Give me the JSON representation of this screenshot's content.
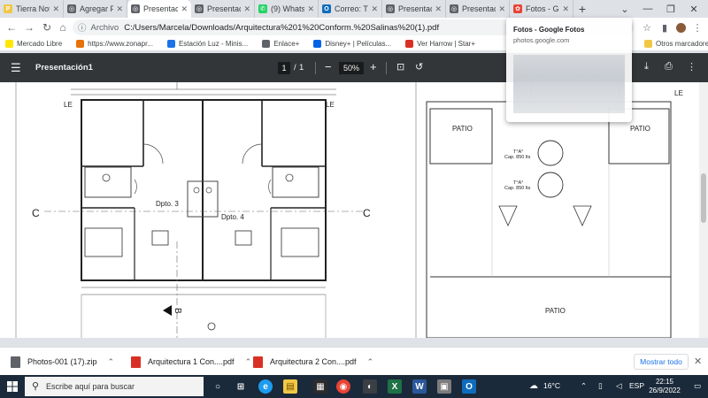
{
  "browser": {
    "tabs": [
      {
        "title": "Tierra Noti",
        "color": "#f2c744",
        "glyph": "P"
      },
      {
        "title": "Agregar Pa",
        "color": "#5f6368",
        "glyph": "◎"
      },
      {
        "title": "Presentaci",
        "color": "#5f6368",
        "glyph": "◎",
        "active": true
      },
      {
        "title": "Presentaci",
        "color": "#5f6368",
        "glyph": "◎"
      },
      {
        "title": "(9) Whats",
        "color": "#25d366",
        "glyph": "✆"
      },
      {
        "title": "Correo: Tie",
        "color": "#0f6cbd",
        "glyph": "O"
      },
      {
        "title": "Presentaci",
        "color": "#5f6368",
        "glyph": "◎"
      },
      {
        "title": "Presentaci",
        "color": "#5f6368",
        "glyph": "◎"
      },
      {
        "title": "Fotos - Go",
        "color": "#ea4335",
        "glyph": "✿"
      }
    ],
    "new_tab": "+",
    "address": {
      "scheme": "Archivo",
      "url": "C:/Users/Marcela/Downloads/Arquitectura%201%20Conform.%20Salinas%20(1).pdf"
    },
    "bookmarks": [
      {
        "label": "Mercado Libre",
        "color": "#ffe600"
      },
      {
        "label": "https://www.zonapr...",
        "color": "#e8710a"
      },
      {
        "label": "Estación Luz - Minis...",
        "color": "#1a73e8"
      },
      {
        "label": "Enlace+",
        "color": "#5f6368"
      },
      {
        "label": "Disney+ | Películas...",
        "color": "#0063e5"
      },
      {
        "label": "Ver Harrow | Star+",
        "color": "#d93025"
      }
    ],
    "other_bookmarks": "Otros marcadores"
  },
  "popup": {
    "title": "Fotos - Google Fotos",
    "url": "photos.google.com"
  },
  "pdf": {
    "title": "Presentación1",
    "page": "1",
    "page_sep": "/",
    "total_pages": "1",
    "zoom": "50%",
    "zoom_out": "−",
    "zoom_in": "+"
  },
  "plan": {
    "le_left": "LE",
    "le_mid": "LE",
    "le_right": "LE",
    "dpto3": "Dpto. 3",
    "dpto4": "Dpto. 4",
    "section_c": "C",
    "section_b": "B",
    "patio_left": "PATIO",
    "patio_right": "PATIO",
    "patio_bottom": "PATIO",
    "tank1_name": "T°A°",
    "tank1_cap": "Cap. 850  lts",
    "tank2_name": "T°A°",
    "tank2_cap": "Cap. 850  lts"
  },
  "downloads": {
    "items": [
      {
        "name": "Photos-001 (17).zip",
        "color": "#5f6368"
      },
      {
        "name": "Arquitectura 1 Con....pdf",
        "color": "#d93025"
      },
      {
        "name": "Arquitectura 2 Con....pdf",
        "color": "#d93025"
      }
    ],
    "show_all": "Mostrar todo"
  },
  "taskbar": {
    "search_placeholder": "Escribe aquí para buscar",
    "temperature": "16°C",
    "language": "ESP",
    "time": "22:15",
    "date": "26/9/2022"
  }
}
